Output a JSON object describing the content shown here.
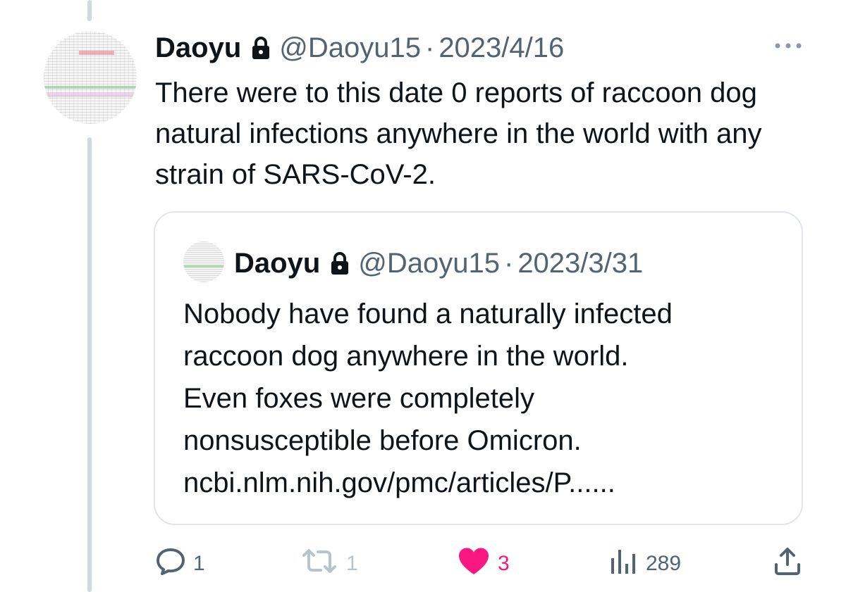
{
  "tweet": {
    "author_name": "Daoyu",
    "handle": "@Daoyu15",
    "separator": "·",
    "date": "2023/4/16",
    "text": "There were to this date 0 reports of raccoon dog natural infections anywhere in the world with any strain of SARS-CoV-2."
  },
  "quoted_tweet": {
    "author_name": "Daoyu",
    "handle": "@Daoyu15",
    "separator": "·",
    "date": "2023/3/31",
    "lines": [
      "Nobody have found a naturally infected",
      "raccoon dog anywhere in the world.",
      "Even foxes were completely",
      "nonsusceptible before Omicron.",
      "ncbi.nlm.nih.gov/pmc/articles/P......"
    ]
  },
  "actions": {
    "reply_count": "1",
    "retweet_count": "1",
    "like_count": "3",
    "view_count": "289"
  },
  "icons": {
    "lock": "lock-icon",
    "more": "more-options-icon",
    "reply": "reply-icon",
    "retweet": "retweet-icon",
    "like": "heart-icon",
    "views": "views-chart-icon",
    "share": "share-icon"
  },
  "colors": {
    "text": "#0f1419",
    "muted": "#536471",
    "like_active": "#f91880",
    "thread_line": "#cfd9de",
    "quote_border": "#dfe5e9",
    "retweet_disabled": "#b8c4cc"
  }
}
